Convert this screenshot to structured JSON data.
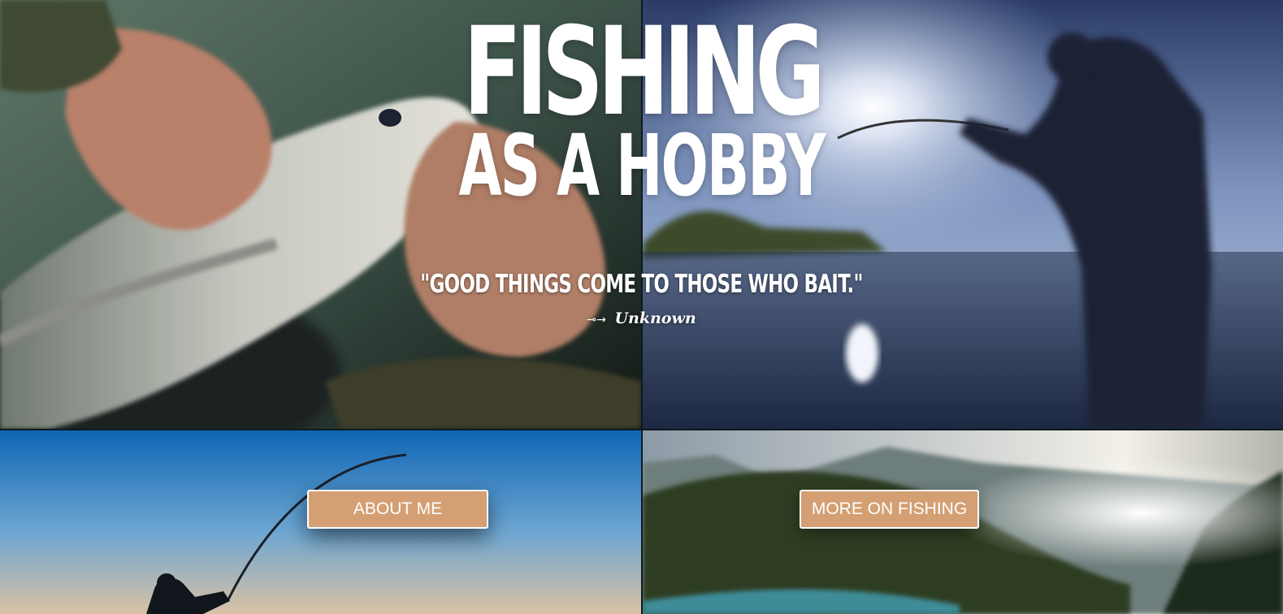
{
  "hero": {
    "title_main": "FISHING",
    "title_sub": "AS A HOBBY",
    "quote": "\"GOOD THINGS COME TO THOSE WHO BAIT.\"",
    "author_arrow": "⊸→",
    "author": "Unknown"
  },
  "buttons": {
    "about_label": "ABOUT ME",
    "more_label": "MORE ON FISHING"
  },
  "colors": {
    "button_fill": "#d49f73",
    "button_border": "#ffffff",
    "text": "#ffffff"
  },
  "images": [
    "hands-holding-fish-photo",
    "angler-silhouette-on-lake-photo",
    "angler-casting-at-dusk-photo",
    "mountain-lake-with-boat-photo"
  ]
}
